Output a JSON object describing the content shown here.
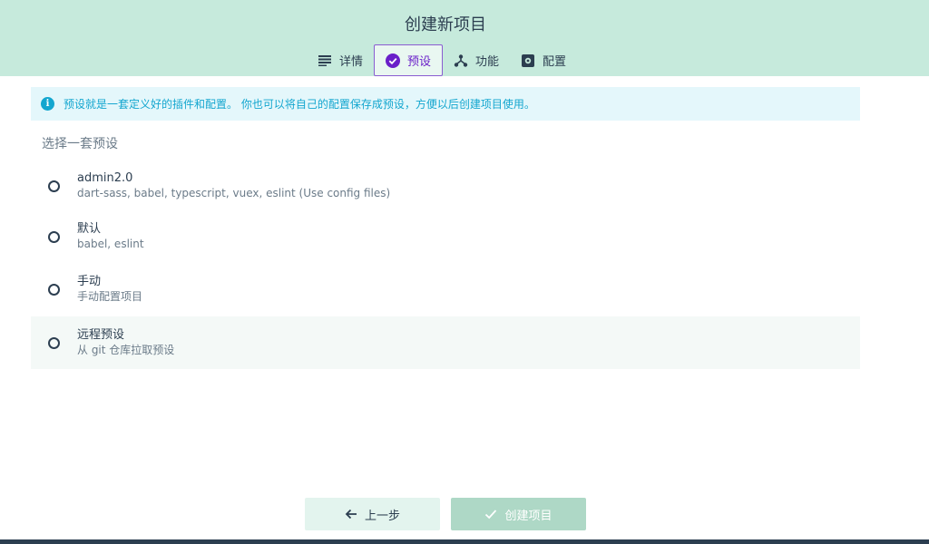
{
  "header": {
    "title": "创建新项目",
    "tabs": [
      {
        "label": "详情",
        "icon": "list-icon"
      },
      {
        "label": "预设",
        "icon": "check-circle-icon",
        "active": true
      },
      {
        "label": "功能",
        "icon": "branch-icon"
      },
      {
        "label": "配置",
        "icon": "settings-icon"
      }
    ]
  },
  "info": {
    "text": "预设就是一套定义好的插件和配置。 你也可以将自己的配置保存成预设，方便以后创建项目使用。"
  },
  "presets": {
    "label": "选择一套预设",
    "options": [
      {
        "name": "admin2.0",
        "desc": "dart-sass, babel, typescript, vuex, eslint (Use config files)"
      },
      {
        "name": "默认",
        "desc": "babel, eslint"
      },
      {
        "name": "手动",
        "desc": "手动配置项目"
      },
      {
        "name": "远程预设",
        "desc": "从 git 仓库拉取预设"
      }
    ]
  },
  "footer": {
    "prev_label": "上一步",
    "create_label": "创建项目"
  },
  "colors": {
    "header_bg": "#c6eadc",
    "accent": "#6a1fc9",
    "info": "#13a6cf"
  }
}
